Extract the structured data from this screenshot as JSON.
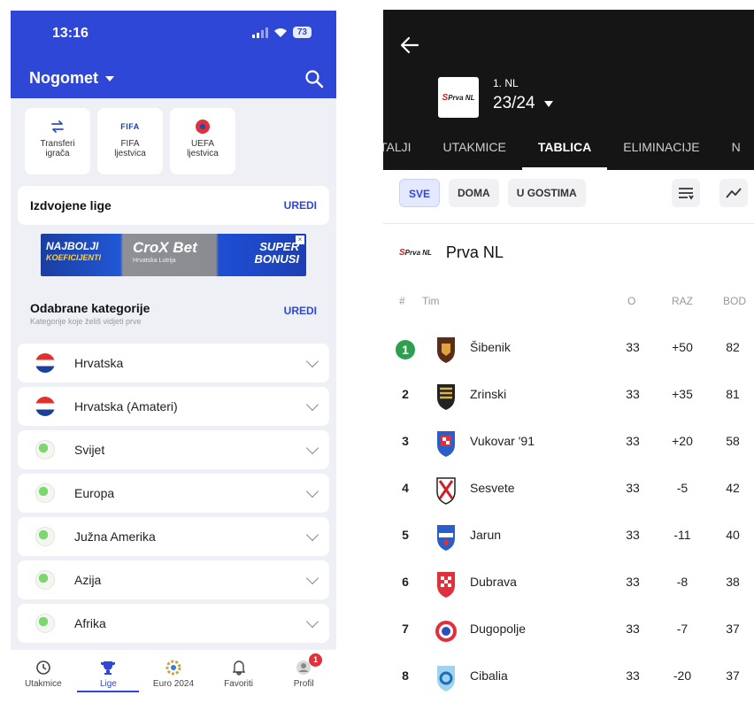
{
  "left": {
    "status": {
      "time": "13:16",
      "battery": "73"
    },
    "header": {
      "title": "Nogomet"
    },
    "shortcuts": [
      {
        "label_line1": "Transferi",
        "label_line2": "igrača",
        "icon": "transfer-icon"
      },
      {
        "label_line1": "FIFA",
        "label_line2": "ljestvica",
        "icon_text": "FIFA"
      },
      {
        "label_line1": "UEFA",
        "label_line2": "ljestvica",
        "icon": "uefa-logo"
      }
    ],
    "featured": {
      "title": "Izdvojene lige",
      "edit": "UREDI"
    },
    "ad": {
      "left_line1": "NAJBOLJI",
      "left_line2": "KOEFICIJENTI",
      "brand": "CroX Bet",
      "brand_sub": "Hrvatska Lutrija",
      "right_line1": "SUPER",
      "right_line2": "BONUSI"
    },
    "categories_section": {
      "title": "Odabrane kategorije",
      "subtitle": "Kategorije koje želiš vidjeti prve",
      "edit": "UREDI"
    },
    "categories": [
      {
        "label": "Hrvatska",
        "flag": "hr"
      },
      {
        "label": "Hrvatska (Amateri)",
        "flag": "hr"
      },
      {
        "label": "Svijet",
        "flag": "globe"
      },
      {
        "label": "Europa",
        "flag": "globe"
      },
      {
        "label": "Južna Amerika",
        "flag": "globe"
      },
      {
        "label": "Azija",
        "flag": "globe"
      },
      {
        "label": "Afrika",
        "flag": "globe"
      }
    ],
    "nav": [
      {
        "label": "Utakmice",
        "icon": "clock-icon"
      },
      {
        "label": "Lige",
        "icon": "trophy-icon",
        "active": true
      },
      {
        "label": "Euro 2024",
        "icon": "euro-icon"
      },
      {
        "label": "Favoriti",
        "icon": "bell-icon"
      },
      {
        "label": "Profil",
        "icon": "profile-icon",
        "badge": "1"
      }
    ],
    "colors": {
      "primary": "#2f47d6"
    }
  },
  "right": {
    "league": {
      "small": "1. NL",
      "season": "23/24",
      "logo_text": "Prva NL"
    },
    "tabs": [
      "TALJI",
      "UTAKMICE",
      "TABLICA",
      "ELIMINACIJE",
      "N"
    ],
    "active_tab": "TABLICA",
    "filters": [
      "SVE",
      "DOMA",
      "U GOSTIMA"
    ],
    "competition": "Prva NL",
    "table_headers": {
      "pos": "#",
      "team": "Tim",
      "played": "O",
      "diff": "RAZ",
      "points": "BOD"
    },
    "rows": [
      {
        "pos": "1",
        "team": "Šibenik",
        "played": "33",
        "diff": "+50",
        "points": "82"
      },
      {
        "pos": "2",
        "team": "Zrinski",
        "played": "33",
        "diff": "+35",
        "points": "81"
      },
      {
        "pos": "3",
        "team": "Vukovar '91",
        "played": "33",
        "diff": "+20",
        "points": "58"
      },
      {
        "pos": "4",
        "team": "Sesvete",
        "played": "33",
        "diff": "-5",
        "points": "42"
      },
      {
        "pos": "5",
        "team": "Jarun",
        "played": "33",
        "diff": "-11",
        "points": "40"
      },
      {
        "pos": "6",
        "team": "Dubrava",
        "played": "33",
        "diff": "-8",
        "points": "38"
      },
      {
        "pos": "7",
        "team": "Dugopolje",
        "played": "33",
        "diff": "-7",
        "points": "37"
      },
      {
        "pos": "8",
        "team": "Cibalia",
        "played": "33",
        "diff": "-20",
        "points": "37"
      }
    ],
    "colors": {
      "leader": "#2e9e4f",
      "header_bg": "#151515"
    }
  }
}
